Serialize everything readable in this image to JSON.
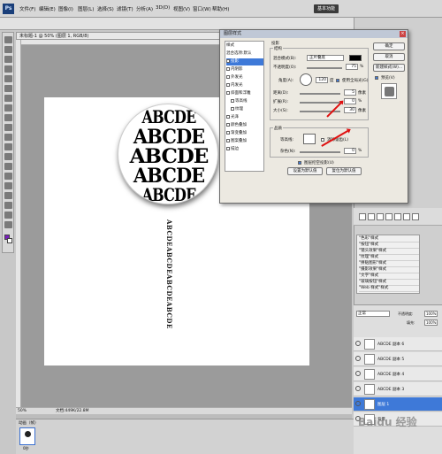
{
  "menubar": {
    "app_icon": "Ps",
    "items": [
      "文件(F)",
      "编辑(E)",
      "图像(I)",
      "图层(L)",
      "选择(S)",
      "滤镜(T)",
      "分析(A)",
      "3D(D)",
      "视图(V)",
      "窗口(W)",
      "帮助(H)"
    ],
    "essentials": "基本功能"
  },
  "document": {
    "tab": "未标题-1 @ 50% (图层 1, RGB/8)",
    "circle_lines": [
      "ABCDE",
      "ABCDE",
      "ABCDE",
      "ABCDE",
      "ABCDE"
    ],
    "stem_text": "ABCDEABCDEABCDEABCDE",
    "status_zoom": "50%",
    "status_doc": "文档:449K/22.8M"
  },
  "animation": {
    "tab": "动画（帧）",
    "frame_time": "0秒"
  },
  "dialog": {
    "title": "图层样式",
    "left_items": [
      "样式",
      "混合选项:默认",
      "投影",
      "内阴影",
      "外发光",
      "内发光",
      "斜面和浮雕",
      "等高线",
      "纹理",
      "光泽",
      "颜色叠加",
      "渐变叠加",
      "图案叠加",
      "描边"
    ],
    "selected_item": "投影",
    "section": "投影",
    "structure": "结构",
    "blend_label": "混合模式(B):",
    "blend_value": "正片叠底",
    "opacity_label": "不透明度(O):",
    "opacity_value": "75",
    "angle_label": "角度(A):",
    "angle_value": "120",
    "angle_unit": "度",
    "global_light": "使用全局光(G)",
    "distance_label": "距离(D):",
    "distance_value": "5",
    "spread_label": "扩展(R):",
    "spread_value": "0",
    "size_label": "大小(S):",
    "size_value": "30",
    "px": "像素",
    "pct": "%",
    "quality": "品质",
    "contour_label": "等高线:",
    "antialias": "消除锯齿(L)",
    "noise_label": "杂色(N):",
    "noise_value": "0",
    "knockout": "图层挖空投影(U)",
    "set_default": "设置为默认值",
    "reset_default": "复位为默认值",
    "ok": "确定",
    "cancel": "取消",
    "new_style": "新建样式(W)...",
    "preview": "预览(V)"
  },
  "styles_panel": {
    "items": [
      "\"色彩\"样式",
      "\"按钮\"样式",
      "\"镜头效果\"样式",
      "\"纹理\"样式",
      "\"拼贴图形\"样式",
      "\"摄影效果\"样式",
      "\"文字\"样式",
      "\"玻璃按钮\"样式",
      "\"Web 样式\"样式"
    ]
  },
  "layers_panel": {
    "blend": "正常",
    "opacity_label": "不透明度:",
    "opacity": "100%",
    "fill_label": "填充:",
    "fill": "100%",
    "layers": [
      "ABCDE 副本 6",
      "ABCDE 副本 5",
      "ABCDE 副本 4",
      "ABCDE 副本 3",
      "图层 1",
      "背景"
    ],
    "selected": "图层 1"
  },
  "watermark": "Baidu 经验",
  "colors": {
    "accent": "#3e79d8",
    "arrow": "#e01010"
  }
}
